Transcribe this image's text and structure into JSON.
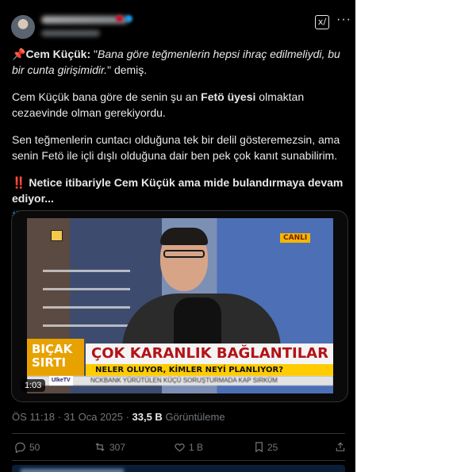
{
  "tweet": {
    "grok_label": "x/",
    "more_label": "···",
    "paragraph1": {
      "pin": "📌",
      "name": "Cem Küçük:",
      "quote_open": " \"",
      "quote": "Bana göre teğmenlerin hepsi ihraç edilmeliydi, bu bir cunta girişimidir.",
      "quote_close": "\"",
      "after": " demiş."
    },
    "paragraph2": {
      "before": "Cem Küçük bana göre de senin şu an ",
      "bold": "Fetö üyesi",
      "after": " olmaktan cezaevinde olman gerekiyordu."
    },
    "paragraph3": "Sen teğmenlerin cuntacı olduğuna tek bir delil gösteremezsin, ama senin Fetö ile içli dışlı olduğuna dair ben pek çok kanıt sunabilirim.",
    "paragraph4": {
      "bang": "‼️",
      "bold": " Netice itibariyle Cem Küçük ama mide bulandırmaya devam ediyor...",
      "hashtag": "#TeğmenlerimizinYanındayız"
    },
    "media": {
      "live_badge": "CANLI",
      "lower_left_line1": "BIÇAK",
      "lower_left_line2": "SIRTI",
      "headline": "ÇOK KARANLIK BAĞLANTILAR",
      "subline": "NELER OLUYOR, KİMLER NEYİ PLANLIYOR?",
      "ticker": "NCKBANK YÜRÜTÜLEN KÜÇÜ SORUŞTURMADA KAP SIRKÜM",
      "ticker_logo": "UlkeTV",
      "duration": "1:03"
    },
    "time": "ÖS 11:18 · 31 Oca 2025 · ",
    "views_count": "33,5 B",
    "views_label": " Görüntüleme",
    "actions": {
      "reply_count": "50",
      "retweet_count": "307",
      "like_count": "1 B",
      "view_count": "25"
    }
  }
}
